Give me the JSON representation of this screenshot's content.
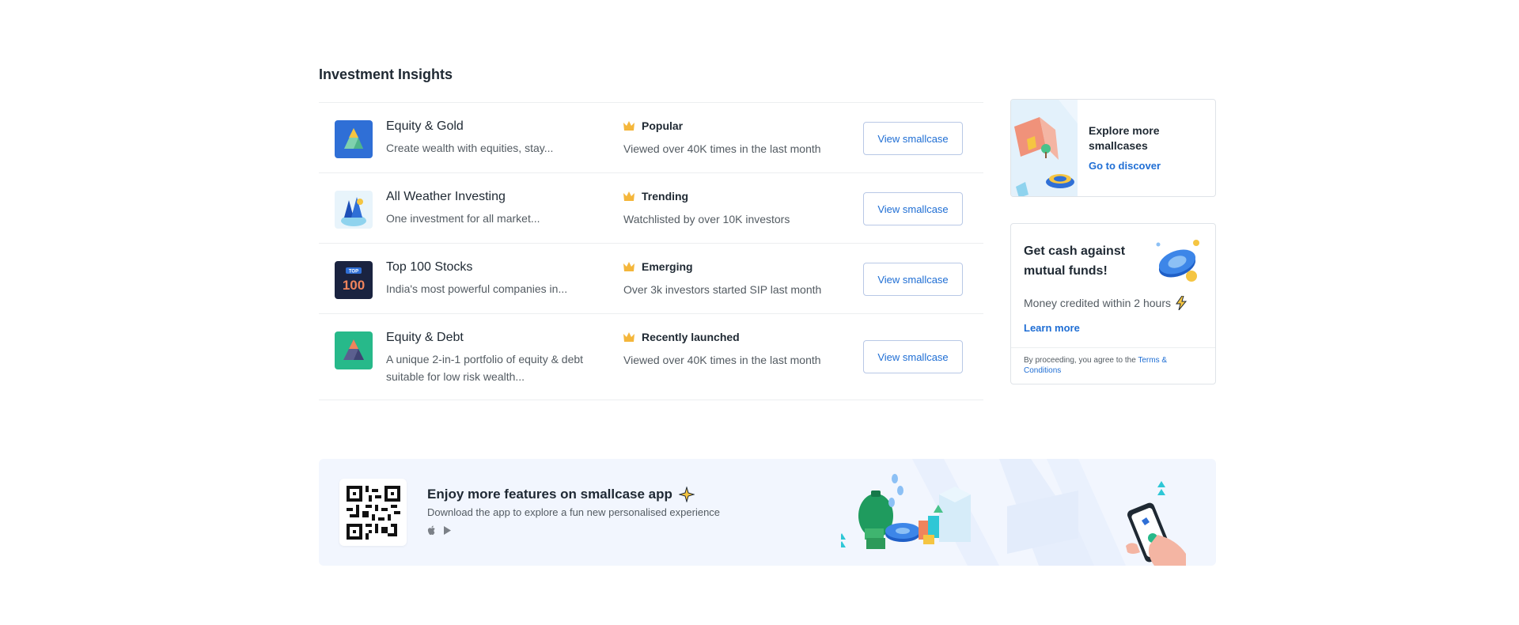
{
  "section": {
    "title": "Investment Insights"
  },
  "insights": [
    {
      "name": "Equity & Gold",
      "description": "Create wealth with equities, stay...",
      "tag": "Popular",
      "stat": "Viewed over 40K times in the last month",
      "button": "View smallcase",
      "icon": "equity-gold-icon"
    },
    {
      "name": "All Weather Investing",
      "description": "One investment for all market...",
      "tag": "Trending",
      "stat": "Watchlisted by over 10K investors",
      "button": "View smallcase",
      "icon": "all-weather-icon"
    },
    {
      "name": "Top 100 Stocks",
      "description": "India's most powerful companies in...",
      "tag": "Emerging",
      "stat": "Over 3k investors started SIP last month",
      "button": "View smallcase",
      "icon": "top-100-icon"
    },
    {
      "name": "Equity & Debt",
      "description": "A unique 2-in-1 portfolio of equity & debt suitable for low risk wealth...",
      "tag": "Recently launched",
      "stat": "Viewed over 40K times in the last month",
      "button": "View smallcase",
      "icon": "equity-debt-icon"
    }
  ],
  "top100_badge": {
    "top": "TOP",
    "number": "100"
  },
  "explore": {
    "title": "Explore more smallcases",
    "link": "Go to discover"
  },
  "cash": {
    "title": "Get cash against mutual funds!",
    "subtitle": "Money credited within 2 hours",
    "link": "Learn more",
    "terms_prefix": "By proceeding, you agree to the ",
    "terms_link": "Terms & Conditions"
  },
  "app_banner": {
    "title": "Enjoy more features on smallcase app",
    "subtitle": "Download the app to explore a fun new personalised experience",
    "icons": [
      "apple-icon",
      "play-store-icon"
    ]
  },
  "colors": {
    "accent": "#1f6ed4",
    "border": "#dfe3e8",
    "banner_bg": "#f2f6fe",
    "crown": "#f4b63b"
  }
}
